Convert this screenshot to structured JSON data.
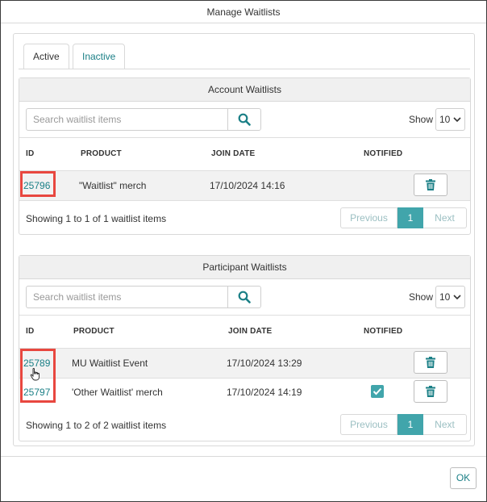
{
  "window": {
    "title": "Manage Waitlists"
  },
  "tabs": [
    {
      "label": "Active",
      "selected": true
    },
    {
      "label": "Inactive",
      "selected": false
    }
  ],
  "account_waitlists": {
    "title": "Account Waitlists",
    "search_placeholder": "Search waitlist items",
    "show_label": "Show",
    "show_value": "10",
    "columns": [
      "ID",
      "PRODUCT",
      "JOIN DATE",
      "NOTIFIED"
    ],
    "rows": [
      {
        "id": "25796",
        "product": "\"Waitlist\" merch",
        "join_date": "17/10/2024 14:16",
        "notified": false
      }
    ],
    "showing": "Showing 1 to 1 of 1 waitlist items",
    "pager": {
      "previous": "Previous",
      "page": "1",
      "next": "Next"
    }
  },
  "participant_waitlists": {
    "title": "Participant Waitlists",
    "search_placeholder": "Search waitlist items",
    "show_label": "Show",
    "show_value": "10",
    "columns": [
      "ID",
      "PRODUCT",
      "JOIN DATE",
      "NOTIFIED"
    ],
    "rows": [
      {
        "id": "25789",
        "product": "MU Waitlist Event",
        "join_date": "17/10/2024 13:29",
        "notified": false
      },
      {
        "id": "25797",
        "product": "'Other Waitlist' merch",
        "join_date": "17/10/2024 14:19",
        "notified": true
      }
    ],
    "showing": "Showing 1 to 2 of 2 waitlist items",
    "pager": {
      "previous": "Previous",
      "page": "1",
      "next": "Next"
    }
  },
  "footer": {
    "ok_label": "OK"
  },
  "icons": {
    "search": "search-icon",
    "trash": "trash-icon",
    "chevron": "chevron-down-icon",
    "check": "check-icon",
    "cursor": "hand-pointer-icon"
  },
  "colors": {
    "accent": "#41a5ab",
    "link": "#1a7f86",
    "highlight": "#e8473f",
    "panel_header": "#f0f0f0"
  }
}
